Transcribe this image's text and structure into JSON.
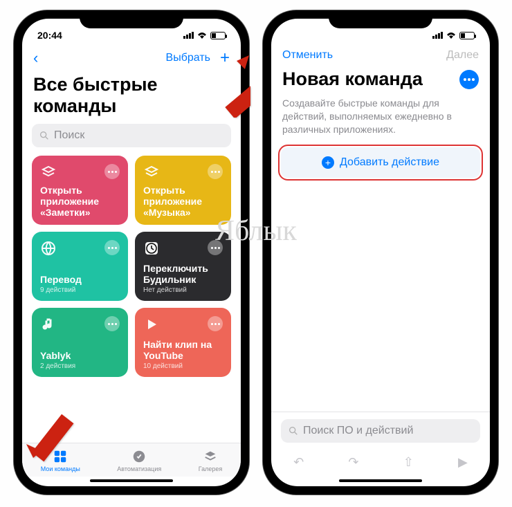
{
  "watermark": "Яблык",
  "left": {
    "time": "20:44",
    "nav_back": "‹",
    "nav_select": "Выбрать",
    "nav_plus": "+",
    "title": "Все быстрые команды",
    "search_placeholder": "Поиск",
    "cards": [
      {
        "name": "Открыть приложение «Заметки»",
        "sub": "",
        "color": "#e04a6c",
        "icon": "layers"
      },
      {
        "name": "Открыть приложение «Музыка»",
        "sub": "",
        "color": "#e7b716",
        "icon": "layers"
      },
      {
        "name": "Перевод",
        "sub": "9 действий",
        "color": "#1fc2a3",
        "icon": "globe"
      },
      {
        "name": "Переключить Будильник",
        "sub": "Нет действий",
        "color": "#2b2b2e",
        "icon": "clock"
      },
      {
        "name": "Yablyk",
        "sub": "2 действия",
        "color": "#22b684",
        "icon": "music"
      },
      {
        "name": "Найти клип на YouTube",
        "sub": "10 действий",
        "color": "#ee6658",
        "icon": "play"
      }
    ],
    "tabs": [
      {
        "label": "Мои команды",
        "active": true
      },
      {
        "label": "Автоматизация",
        "active": false
      },
      {
        "label": "Галерея",
        "active": false
      }
    ]
  },
  "right": {
    "nav_cancel": "Отменить",
    "nav_next": "Далее",
    "title": "Новая команда",
    "subtitle": "Создавайте быстрые команды для действий, выполняемых ежедневно в различных приложениях.",
    "add_label": "Добавить действие",
    "search_placeholder": "Поиск ПО и действий"
  }
}
